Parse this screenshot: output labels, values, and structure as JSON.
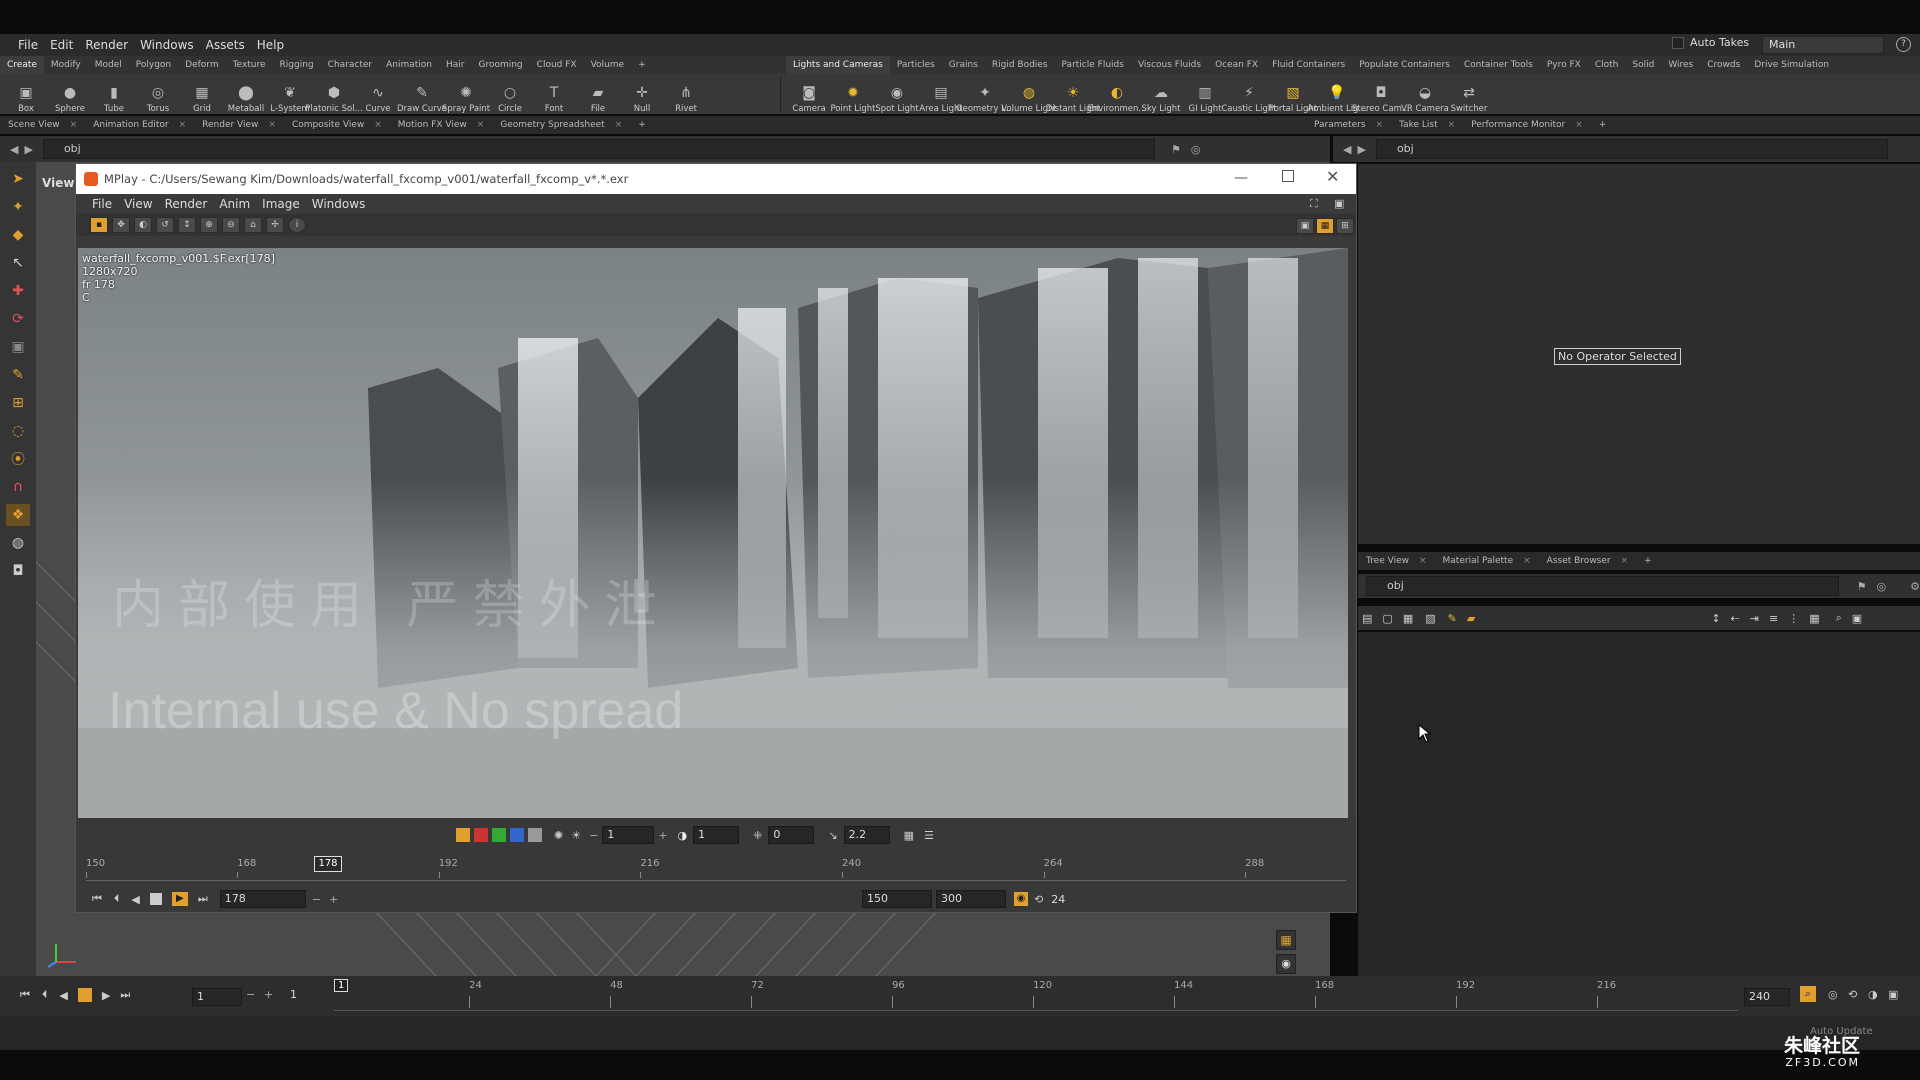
{
  "menubar": {
    "items": [
      "File",
      "Edit",
      "Render",
      "Windows",
      "Assets",
      "Help"
    ],
    "auto_takes": "Auto Takes",
    "desktop": "Main"
  },
  "shelf_tabs_left": [
    "Create",
    "Modify",
    "Model",
    "Polygon",
    "Deform",
    "Texture",
    "Rigging",
    "Character",
    "Animation",
    "Hair",
    "Grooming",
    "Cloud FX",
    "Volume"
  ],
  "shelf_tabs_right": [
    "Lights and Cameras",
    "Particles",
    "Grains",
    "Rigid Bodies",
    "Particle Fluids",
    "Viscous Fluids",
    "Ocean FX",
    "Fluid Containers",
    "Populate Containers",
    "Container Tools",
    "Pyro FX",
    "Cloth",
    "Solid",
    "Wires",
    "Crowds",
    "Drive Simulation"
  ],
  "tools_left": [
    {
      "label": "Box",
      "icon": "box-icon"
    },
    {
      "label": "Sphere",
      "icon": "sphere-icon"
    },
    {
      "label": "Tube",
      "icon": "tube-icon"
    },
    {
      "label": "Torus",
      "icon": "torus-icon"
    },
    {
      "label": "Grid",
      "icon": "grid-icon"
    },
    {
      "label": "Metaball",
      "icon": "metaball-icon"
    },
    {
      "label": "L-System",
      "icon": "lsystem-icon"
    },
    {
      "label": "Platonic Sol...",
      "icon": "platonic-icon"
    },
    {
      "label": "Curve",
      "icon": "curve-icon"
    },
    {
      "label": "Draw Curve",
      "icon": "draw-curve-icon"
    },
    {
      "label": "Spray Paint",
      "icon": "spray-paint-icon"
    },
    {
      "label": "Circle",
      "icon": "circle-icon"
    },
    {
      "label": "Font",
      "icon": "font-icon"
    },
    {
      "label": "File",
      "icon": "file-icon"
    },
    {
      "label": "Null",
      "icon": "null-icon"
    },
    {
      "label": "Rivet",
      "icon": "rivet-icon"
    }
  ],
  "tools_right": [
    {
      "label": "Camera",
      "icon": "camera-icon"
    },
    {
      "label": "Point Light",
      "icon": "point-light-icon"
    },
    {
      "label": "Spot Light",
      "icon": "spot-light-icon"
    },
    {
      "label": "Area Light",
      "icon": "area-light-icon"
    },
    {
      "label": "Geometry L...",
      "icon": "geometry-light-icon"
    },
    {
      "label": "Volume Light",
      "icon": "volume-light-icon"
    },
    {
      "label": "Distant Light",
      "icon": "distant-light-icon"
    },
    {
      "label": "Environmen...",
      "icon": "environment-light-icon"
    },
    {
      "label": "Sky Light",
      "icon": "sky-light-icon"
    },
    {
      "label": "GI Light",
      "icon": "gi-light-icon"
    },
    {
      "label": "Caustic Light",
      "icon": "caustic-light-icon"
    },
    {
      "label": "Portal Light",
      "icon": "portal-light-icon"
    },
    {
      "label": "Ambient Lig...",
      "icon": "ambient-light-icon"
    },
    {
      "label": "Stereo Cam...",
      "icon": "stereo-camera-icon"
    },
    {
      "label": "VR Camera",
      "icon": "vr-camera-icon"
    },
    {
      "label": "Switcher",
      "icon": "switcher-icon"
    }
  ],
  "pane_tabs_left": [
    "Scene View",
    "Animation Editor",
    "Render View",
    "Composite View",
    "Motion FX View",
    "Geometry Spreadsheet"
  ],
  "pane_tabs_right": [
    "Parameters",
    "Take List",
    "Performance Monitor"
  ],
  "path_left": "obj",
  "path_right": "obj",
  "viewport_label": "View",
  "no_operator": "No Operator Selected",
  "tree_tabs": [
    "Tree View",
    "Material Palette",
    "Asset Browser"
  ],
  "tree_path": "obj",
  "mplay": {
    "title": "MPlay - C:/Users/Sewang Kim/Downloads/waterfall_fxcomp_v001/waterfall_fxcomp_v*.*.exr",
    "menu": [
      "File",
      "View",
      "Render",
      "Anim",
      "Image",
      "Windows"
    ],
    "info_file": "waterfall_fxcomp_v001.$F.exr[178]",
    "info_res": "1280x720",
    "info_frame": "fr 178",
    "info_channel": "C",
    "watermark_cn": "内部使用 严禁外泄",
    "watermark_en": "Internal use & No spread",
    "field_a": "1",
    "field_b": "1",
    "field_c": "0",
    "gamma": "2.2",
    "ruler_labels": [
      "150",
      "168",
      "192",
      "216",
      "240",
      "264",
      "288"
    ],
    "current_frame": "178",
    "frame_field": "178",
    "range_start": "150",
    "range_end": "300",
    "fps": "24"
  },
  "timeline": {
    "start_field": "1",
    "step_field": "1",
    "current": "1",
    "labels": [
      "24",
      "48",
      "72",
      "96",
      "120",
      "144",
      "168",
      "192",
      "216"
    ],
    "end_field": "240",
    "auto_update": "Auto Update"
  },
  "branding": {
    "cn": "朱峰社区",
    "en": "ZF3D.COM"
  }
}
